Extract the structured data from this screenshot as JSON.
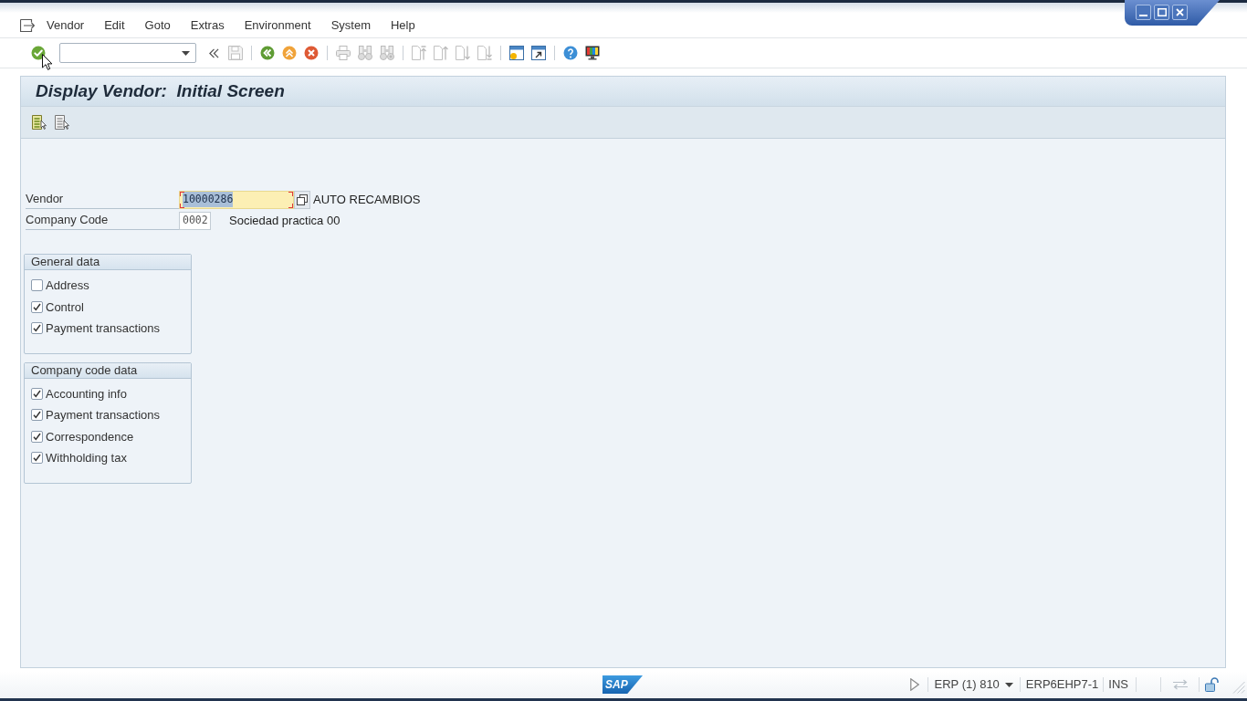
{
  "menu_bar": [
    "Vendor",
    "Edit",
    "Goto",
    "Extras",
    "Environment",
    "System",
    "Help"
  ],
  "toolbar": {
    "groups": [
      [
        {
          "kind": "enter",
          "disabled": false
        },
        {
          "kind": "command",
          "disabled": false
        },
        {
          "kind": "fold",
          "disabled": false
        },
        {
          "kind": "save",
          "disabled": true
        }
      ],
      [
        {
          "kind": "back",
          "disabled": false
        },
        {
          "kind": "exit",
          "disabled": false
        },
        {
          "kind": "cancel",
          "disabled": false
        }
      ],
      [
        {
          "kind": "print",
          "disabled": true
        },
        {
          "kind": "find",
          "disabled": true
        },
        {
          "kind": "find_next",
          "disabled": true
        }
      ],
      [
        {
          "kind": "first_page",
          "disabled": true
        },
        {
          "kind": "previous_page",
          "disabled": true
        },
        {
          "kind": "next_page",
          "disabled": true
        },
        {
          "kind": "last_page",
          "disabled": true
        }
      ],
      [
        {
          "kind": "new_session",
          "disabled": false
        },
        {
          "kind": "shortcut",
          "disabled": false
        }
      ],
      [
        {
          "kind": "help",
          "disabled": false
        },
        {
          "kind": "layout",
          "disabled": false
        }
      ]
    ]
  },
  "screen_title": "Display Vendor:  Initial Screen",
  "fields": [
    {
      "label": "Vendor",
      "value": "10000286",
      "kind": "long",
      "focused": true,
      "description": "AUTO RECAMBIOS"
    },
    {
      "label": "Company Code",
      "value": "0002",
      "kind": "short",
      "focused": false,
      "description": "Sociedad practica 00"
    }
  ],
  "groups": [
    {
      "title": "General data",
      "options": [
        {
          "label": "Address",
          "checked": false
        },
        {
          "label": "Control",
          "checked": true
        },
        {
          "label": "Payment transactions",
          "checked": true
        }
      ]
    },
    {
      "title": "Company code data",
      "options": [
        {
          "label": "Accounting info",
          "checked": true
        },
        {
          "label": "Payment transactions",
          "checked": true
        },
        {
          "label": "Correspondence",
          "checked": true
        },
        {
          "label": "Withholding tax",
          "checked": true
        }
      ]
    }
  ],
  "status_bar": {
    "logo": "SAP",
    "system": "ERP (1) 810",
    "server": "ERP6EHP7-1",
    "mode": "INS"
  }
}
